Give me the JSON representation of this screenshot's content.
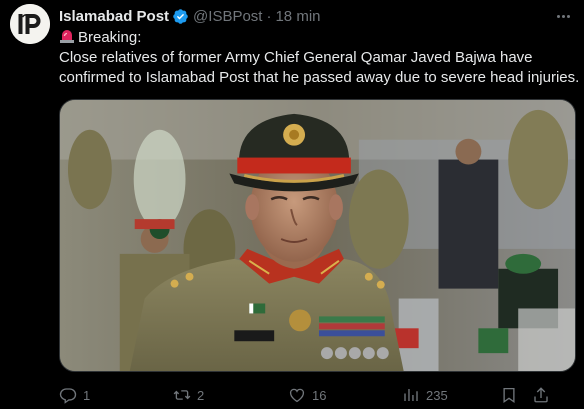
{
  "account": {
    "display_name": "Islamabad Post",
    "handle": "@ISBPost",
    "separator": "·",
    "timestamp": "18 min",
    "verified": true,
    "avatar_monogram": "IP"
  },
  "tweet": {
    "label": "Breaking:",
    "label_icon": "rotating-light-emoji",
    "text_line_1": "Close relatives of former Army Chief General Qamar Javed Bajwa have",
    "text_line_2": "confirmed to Islamabad Post that he passed away due to severe head injuries."
  },
  "media": {
    "name_tape": "BAJWA"
  },
  "actions": {
    "replies": "1",
    "reposts": "2",
    "likes": "16",
    "views": "235"
  },
  "colors": {
    "background": "#000000",
    "text": "#e7e9ea",
    "muted": "#71767b",
    "verified": "#1d9bf0"
  }
}
